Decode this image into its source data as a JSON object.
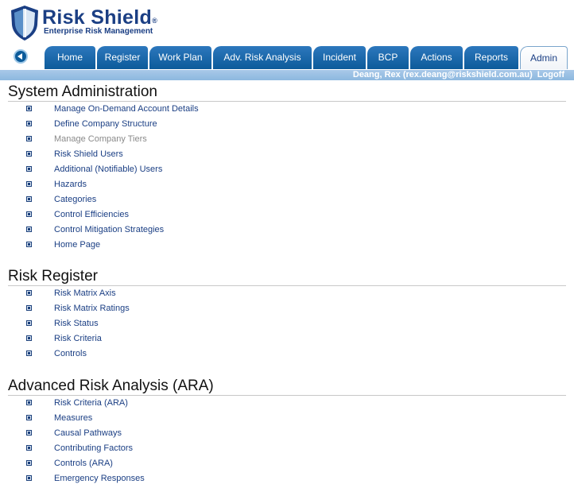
{
  "brand": {
    "name": "Risk Shield",
    "trademark": "®",
    "tagline": "Enterprise Risk Management"
  },
  "nav": {
    "tabs": [
      {
        "label": "Home",
        "active": false
      },
      {
        "label": "Register",
        "active": false
      },
      {
        "label": "Work Plan",
        "active": false
      },
      {
        "label": "Adv. Risk Analysis",
        "active": false
      },
      {
        "label": "Incident",
        "active": false
      },
      {
        "label": "BCP",
        "active": false
      },
      {
        "label": "Actions",
        "active": false
      },
      {
        "label": "Reports",
        "active": false
      },
      {
        "label": "Admin",
        "active": true
      }
    ],
    "colors": {
      "tab": "#0c5b9a",
      "tab_light": "#2d78bd",
      "bar": "#8db8df"
    }
  },
  "user": {
    "info": "Deang, Rex (rex.deang@riskshield.com.au)",
    "logoff": "Logoff"
  },
  "sections": [
    {
      "title": "System Administration",
      "items": [
        {
          "label": "Manage On-Demand Account Details",
          "muted": false
        },
        {
          "label": "Define Company Structure",
          "muted": false
        },
        {
          "label": "Manage Company Tiers",
          "muted": true
        },
        {
          "label": "Risk Shield Users",
          "muted": false
        },
        {
          "label": "Additional (Notifiable) Users",
          "muted": false
        },
        {
          "label": "Hazards",
          "muted": false
        },
        {
          "label": "Categories",
          "muted": false
        },
        {
          "label": "Control Efficiencies",
          "muted": false
        },
        {
          "label": "Control Mitigation Strategies",
          "muted": false
        },
        {
          "label": "Home Page",
          "muted": false
        }
      ]
    },
    {
      "title": "Risk Register",
      "items": [
        {
          "label": "Risk Matrix Axis",
          "muted": false
        },
        {
          "label": "Risk Matrix Ratings",
          "muted": false
        },
        {
          "label": "Risk Status",
          "muted": false
        },
        {
          "label": "Risk Criteria",
          "muted": false
        },
        {
          "label": "Controls",
          "muted": false
        }
      ]
    },
    {
      "title": "Advanced Risk Analysis (ARA)",
      "items": [
        {
          "label": "Risk Criteria (ARA)",
          "muted": false
        },
        {
          "label": "Measures",
          "muted": false
        },
        {
          "label": "Causal Pathways",
          "muted": false
        },
        {
          "label": "Contributing Factors",
          "muted": false
        },
        {
          "label": "Controls (ARA)",
          "muted": false
        },
        {
          "label": "Emergency Responses",
          "muted": false
        }
      ]
    }
  ]
}
